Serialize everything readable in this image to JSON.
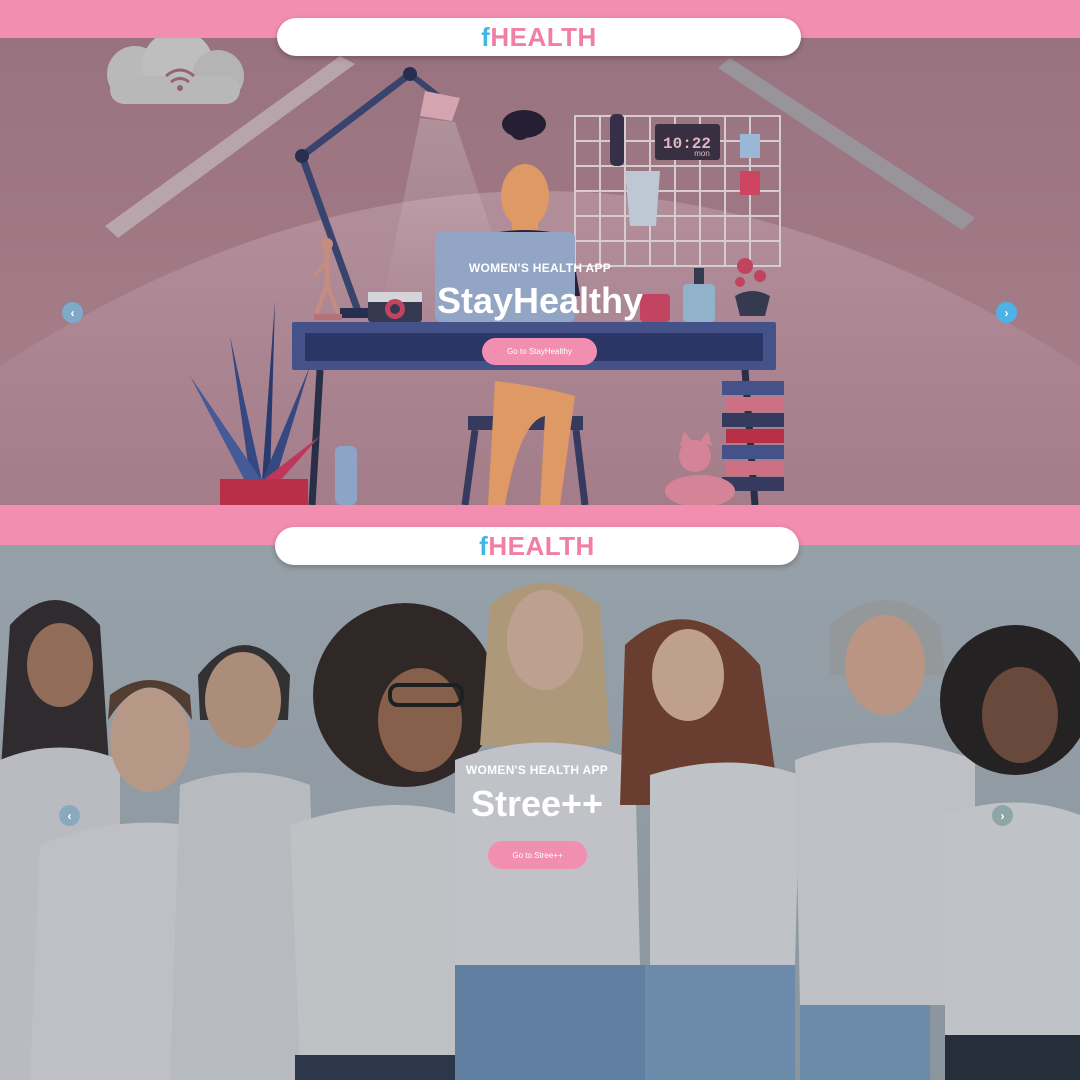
{
  "slides": [
    {
      "brand_prefix": "f",
      "brand_name": "HEALTH",
      "kicker": "WOMEN'S HEALTH APP",
      "title": "StayHealthy",
      "cta_label": "Go to StayHealthy",
      "clock_time": "10:22",
      "clock_day": "mon",
      "prev_icon": "chevron-left-icon",
      "next_icon": "chevron-right-icon"
    },
    {
      "brand_prefix": "f",
      "brand_name": "HEALTH",
      "kicker": "WOMEN'S HEALTH APP",
      "title": "Stree++",
      "cta_label": "Go to Stree++",
      "prev_icon": "chevron-left-icon",
      "next_icon": "chevron-right-icon"
    }
  ],
  "colors": {
    "brand_pink": "#f28fb0",
    "brand_blue": "#3fb6e8",
    "top_bg": "#a47c8a",
    "bottom_bg": "#8f9aa3"
  }
}
